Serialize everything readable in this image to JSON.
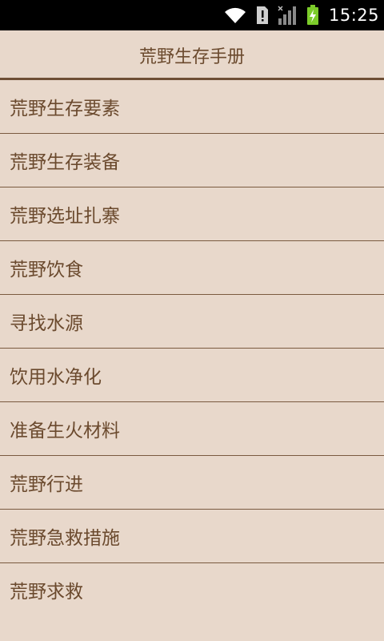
{
  "status_bar": {
    "time": "15:25",
    "icons": [
      "wifi-icon",
      "sim-alert-icon",
      "signal-icon",
      "battery-charging-icon"
    ],
    "battery_color": "#7ccc2a"
  },
  "header": {
    "title": "荒野生存手册"
  },
  "menu": {
    "items": [
      {
        "label": "荒野生存要素"
      },
      {
        "label": "荒野生存装备"
      },
      {
        "label": "荒野选址扎寨"
      },
      {
        "label": "荒野饮食"
      },
      {
        "label": "寻找水源"
      },
      {
        "label": "饮用水净化"
      },
      {
        "label": "准备生火材料"
      },
      {
        "label": "荒野行进"
      },
      {
        "label": "荒野急救措施"
      },
      {
        "label": "荒野求救"
      }
    ]
  },
  "colors": {
    "background": "#e8d8cb",
    "text": "#6b4a2e",
    "divider": "#7a5a40"
  }
}
